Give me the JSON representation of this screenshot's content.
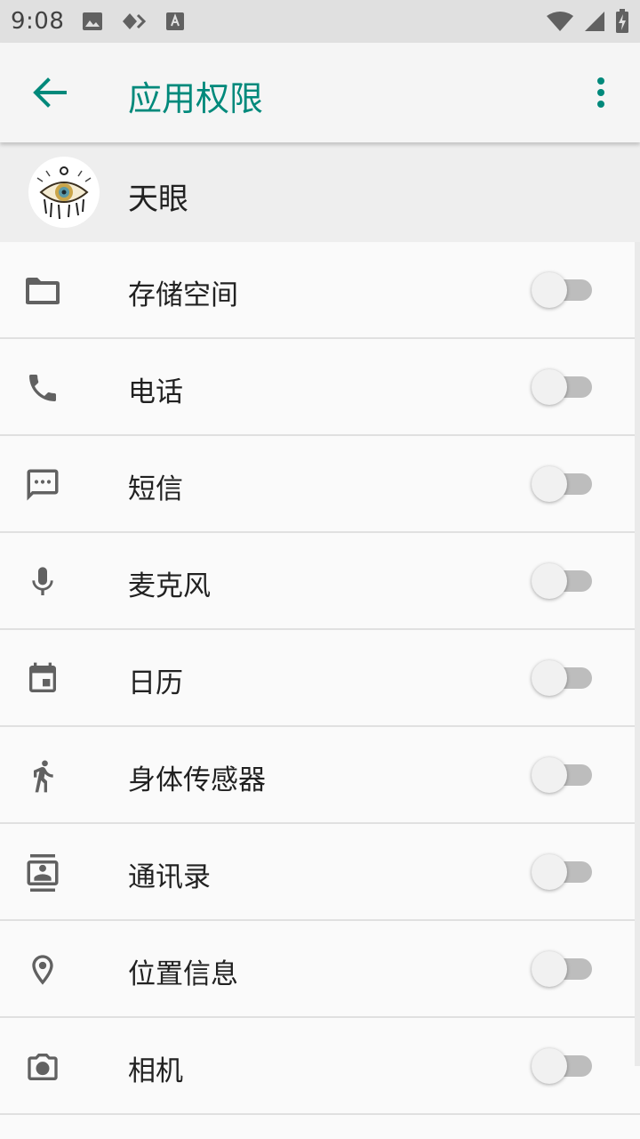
{
  "status_bar": {
    "time": "9:08",
    "left_icons": [
      "image-icon",
      "sync-icon",
      "keyboard-icon"
    ],
    "right_icons": [
      "wifi-icon",
      "signal-icon",
      "battery-charging-icon"
    ]
  },
  "app_bar": {
    "title": "应用权限",
    "back_icon": "arrow-back-icon",
    "more_icon": "more-vert-icon",
    "accent_color": "#00897b"
  },
  "app": {
    "name": "天眼",
    "icon": "eye-logo"
  },
  "permissions": [
    {
      "label": "存储空间",
      "icon": "folder-icon",
      "enabled": false
    },
    {
      "label": "电话",
      "icon": "phone-icon",
      "enabled": false
    },
    {
      "label": "短信",
      "icon": "sms-icon",
      "enabled": false
    },
    {
      "label": "麦克风",
      "icon": "microphone-icon",
      "enabled": false
    },
    {
      "label": "日历",
      "icon": "calendar-icon",
      "enabled": false
    },
    {
      "label": "身体传感器",
      "icon": "body-sensor-icon",
      "enabled": false
    },
    {
      "label": "通讯录",
      "icon": "contacts-icon",
      "enabled": false
    },
    {
      "label": "位置信息",
      "icon": "location-icon",
      "enabled": false
    },
    {
      "label": "相机",
      "icon": "camera-icon",
      "enabled": false
    }
  ]
}
